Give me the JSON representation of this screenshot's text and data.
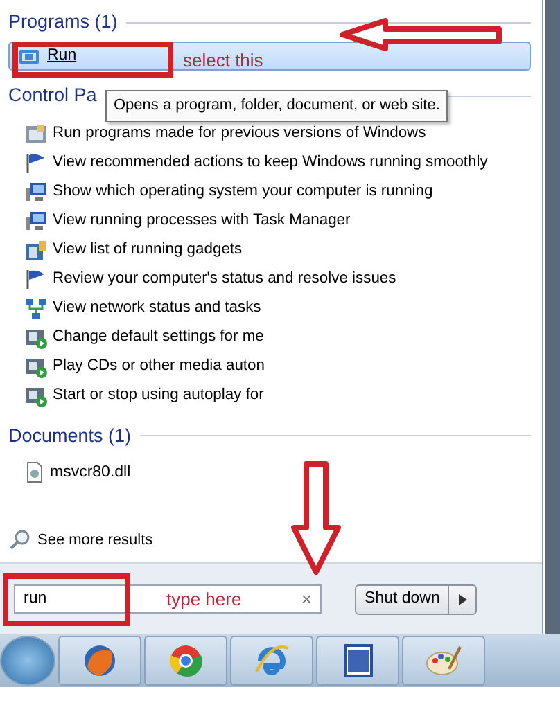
{
  "programs": {
    "heading": "Programs (1)",
    "items": [
      {
        "label": "Run",
        "selected": true
      }
    ]
  },
  "tooltip": "Opens a program, folder, document, or web site.",
  "control_panel": {
    "heading": "Control Pa",
    "items": [
      {
        "label": "Run programs made for previous versions of Windows",
        "kind": "program"
      },
      {
        "label": "View recommended actions to keep Windows running smoothly",
        "kind": "flag"
      },
      {
        "label": "Show which operating system your computer is running",
        "kind": "monitor"
      },
      {
        "label": "View running processes with Task Manager",
        "kind": "monitor"
      },
      {
        "label": "View list of running gadgets",
        "kind": "gadget"
      },
      {
        "label": "Review your computer's status and resolve issues",
        "kind": "flag"
      },
      {
        "label": "View network status and tasks",
        "kind": "network"
      },
      {
        "label": "Change default settings for me",
        "kind": "media"
      },
      {
        "label": "Play CDs or other media auton",
        "kind": "media"
      },
      {
        "label": "Start or stop using autoplay for",
        "kind": "media"
      }
    ]
  },
  "documents": {
    "heading": "Documents (1)",
    "items": [
      {
        "label": "msvcr80.dll"
      }
    ]
  },
  "see_more": "See more results",
  "search": {
    "value": "run",
    "clear": "×"
  },
  "shutdown": {
    "label": "Shut down"
  },
  "annotations": [
    {
      "text": "select this",
      "kind": "arrow-left"
    },
    {
      "text": "type here",
      "kind": "arrow-down"
    }
  ]
}
